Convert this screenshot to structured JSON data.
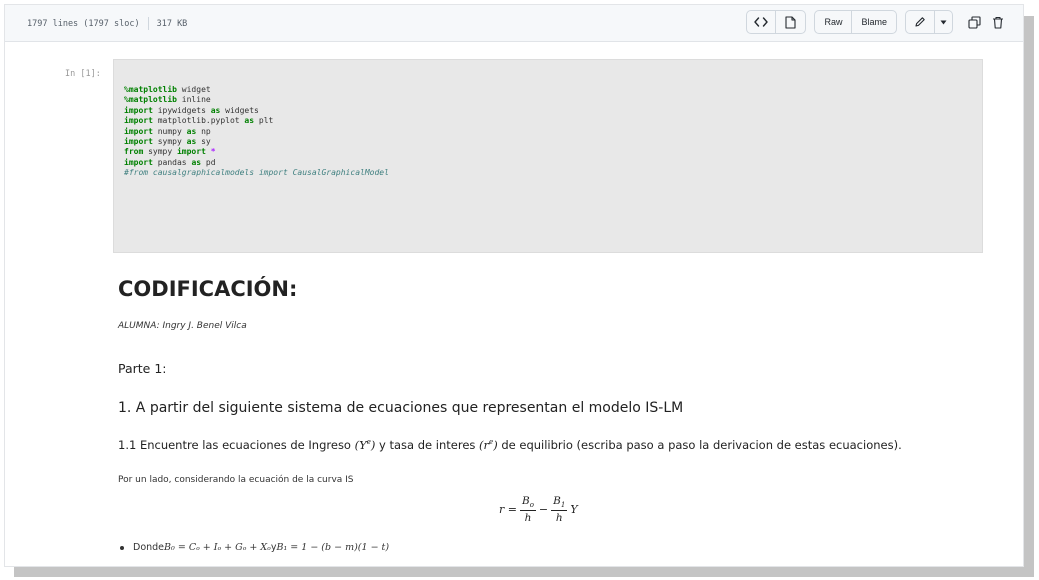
{
  "file_info": {
    "lines": "1797 lines (1797 sloc)",
    "size": "317 KB"
  },
  "toolbar": {
    "code_icon": "code-brackets-icon",
    "file_icon": "file-icon",
    "raw_label": "Raw",
    "blame_label": "Blame",
    "edit_icon": "pencil-icon",
    "dropdown_icon": "triangle-down-icon",
    "copy_icon": "copy-icon",
    "delete_icon": "trash-icon"
  },
  "cell": {
    "prompt": "In [1]:",
    "lines": [
      [
        {
          "t": "%matplotlib",
          "c": "kw"
        },
        {
          "t": " widget",
          "c": ""
        }
      ],
      [
        {
          "t": "%matplotlib",
          "c": "kw"
        },
        {
          "t": " inline",
          "c": ""
        }
      ],
      [
        {
          "t": "import",
          "c": "kw"
        },
        {
          "t": " ipywidgets ",
          "c": ""
        },
        {
          "t": "as",
          "c": "kw"
        },
        {
          "t": " widgets",
          "c": ""
        }
      ],
      [
        {
          "t": "import",
          "c": "kw"
        },
        {
          "t": " matplotlib.pyplot ",
          "c": ""
        },
        {
          "t": "as",
          "c": "kw"
        },
        {
          "t": " plt",
          "c": ""
        }
      ],
      [
        {
          "t": "import",
          "c": "kw"
        },
        {
          "t": " numpy ",
          "c": ""
        },
        {
          "t": "as",
          "c": "kw"
        },
        {
          "t": " np",
          "c": ""
        }
      ],
      [
        {
          "t": "import",
          "c": "kw"
        },
        {
          "t": " sympy ",
          "c": ""
        },
        {
          "t": "as",
          "c": "kw"
        },
        {
          "t": " sy",
          "c": ""
        }
      ],
      [
        {
          "t": "from",
          "c": "kw"
        },
        {
          "t": " sympy ",
          "c": ""
        },
        {
          "t": "import",
          "c": "kw"
        },
        {
          "t": " ",
          "c": ""
        },
        {
          "t": "*",
          "c": "op"
        }
      ],
      [
        {
          "t": "import",
          "c": "kw"
        },
        {
          "t": " pandas ",
          "c": ""
        },
        {
          "t": "as",
          "c": "kw"
        },
        {
          "t": " pd",
          "c": ""
        }
      ],
      [
        {
          "t": "#from causalgraphicalmodels import CausalGraphicalModel",
          "c": "cm"
        }
      ]
    ]
  },
  "markdown": {
    "title": "CODIFICACIÓN:",
    "author": "ALUMNA: Ingry J. Benel Vilca",
    "part": "Parte 1:",
    "section": "1. A partir del siguiente sistema de ecuaciones que representan el modelo IS-LM",
    "subsection_a": "1.1 Encuentre las ecuaciones de Ingreso ",
    "subsection_math1": "(Y",
    "subsection_sup1": "e",
    "subsection_math1_close": ")",
    "subsection_b": " y tasa de interes ",
    "subsection_math2": "(r",
    "subsection_sup2": "e",
    "subsection_math2_close": ")",
    "subsection_c": " de equilibrio (escriba paso a paso la derivacion de estas ecuaciones).",
    "paragraph": "Por un lado, considerando la ecuación de la curva IS",
    "eq_lhs": "r =",
    "eq_frac1_num": "B",
    "eq_frac1_num_sub": "o",
    "eq_frac1_den": "h",
    "eq_minus": "−",
    "eq_frac2_num": "B",
    "eq_frac2_num_sub": "1",
    "eq_frac2_den": "h",
    "eq_tail": "Y",
    "bullet_prefix": "Donde ",
    "bullet_math1": "B₀ = Cₒ + Iₒ + Gₒ + Xₒ",
    "bullet_mid": " y ",
    "bullet_math2": "B₁ = 1 − (b − m)(1 − t)"
  }
}
